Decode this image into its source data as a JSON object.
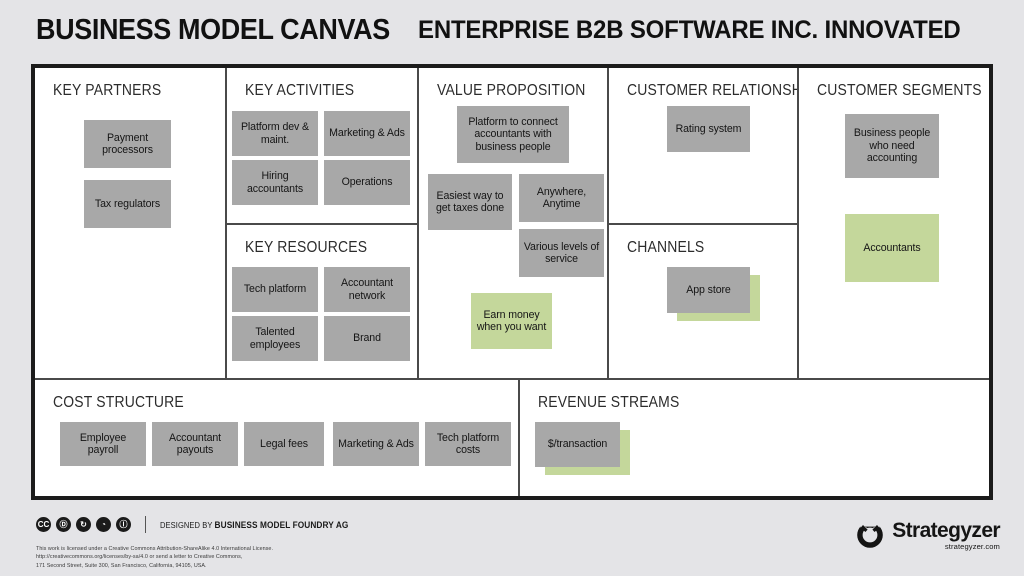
{
  "header": {
    "title": "BUSINESS MODEL CANVAS",
    "subtitle": "ENTERPRISE B2B SOFTWARE INC. INNOVATED"
  },
  "colors": {
    "page_background": "#e4e4e7",
    "canvas_background": "#ffffff",
    "frame": "#1b1b1b",
    "divider": "#4a4a4a",
    "card_gray": "#a8a8a8",
    "card_green": "#c4d79b",
    "text": "#151515"
  },
  "blocks": [
    {
      "id": "key-partners",
      "title": "KEY PARTNERS",
      "cards": [
        {
          "label": "Payment processors",
          "color": "gray"
        },
        {
          "label": "Tax regulators",
          "color": "gray"
        }
      ]
    },
    {
      "id": "key-activities",
      "title": "KEY ACTIVITIES",
      "cards": [
        {
          "label": "Platform dev & maint.",
          "color": "gray"
        },
        {
          "label": "Marketing & Ads",
          "color": "gray"
        },
        {
          "label": "Hiring accountants",
          "color": "gray"
        },
        {
          "label": "Operations",
          "color": "gray"
        }
      ]
    },
    {
      "id": "key-resources",
      "title": "KEY RESOURCES",
      "cards": [
        {
          "label": "Tech platform",
          "color": "gray"
        },
        {
          "label": "Accountant network",
          "color": "gray"
        },
        {
          "label": "Talented employees",
          "color": "gray"
        },
        {
          "label": "Brand",
          "color": "gray"
        }
      ]
    },
    {
      "id": "value-proposition",
      "title": "VALUE PROPOSITION",
      "cards": [
        {
          "label": "Platform to connect accountants with business people",
          "color": "gray"
        },
        {
          "label": "Easiest way to get taxes done",
          "color": "gray"
        },
        {
          "label": "Anywhere, Anytime",
          "color": "gray"
        },
        {
          "label": "Various levels of service",
          "color": "gray"
        },
        {
          "label": "Earn money when you want",
          "color": "green"
        }
      ]
    },
    {
      "id": "customer-relationships",
      "title": "CUSTOMER RELATIONSHIPS",
      "cards": [
        {
          "label": "Rating system",
          "color": "gray"
        }
      ]
    },
    {
      "id": "channels",
      "title": "CHANNELS",
      "cards": [
        {
          "label": "App store",
          "color": "gray",
          "stacked": true
        }
      ]
    },
    {
      "id": "customer-segments",
      "title": "CUSTOMER SEGMENTS",
      "cards": [
        {
          "label": "Business people who need accounting",
          "color": "gray"
        },
        {
          "label": "Accountants",
          "color": "green"
        }
      ]
    },
    {
      "id": "cost-structure",
      "title": "COST STRUCTURE",
      "cards": [
        {
          "label": "Employee payroll",
          "color": "gray"
        },
        {
          "label": "Accountant payouts",
          "color": "gray"
        },
        {
          "label": "Legal fees",
          "color": "gray"
        },
        {
          "label": "Marketing & Ads",
          "color": "gray"
        },
        {
          "label": "Tech platform costs",
          "color": "gray"
        }
      ]
    },
    {
      "id": "revenue-streams",
      "title": "REVENUE STREAMS",
      "cards": [
        {
          "label": "$/transaction",
          "color": "gray",
          "stacked": true
        }
      ]
    }
  ],
  "footer": {
    "cc_icons": [
      "cc-icon",
      "cc-copy-icon",
      "cc-sharealike-icon",
      "cc-remix-icon",
      "cc-by-icon"
    ],
    "cc_glyphs": [
      "CC",
      "Ⓓ",
      "↻",
      "◔",
      "Ⓘ"
    ],
    "designed_by_prefix": "DESIGNED BY ",
    "designed_by_name": "BUSINESS MODEL FOUNDRY AG",
    "license": "This work is licensed under a Creative Commons Attribution-ShareAlike 4.0 International License.\nhttp://creativecommons.org/licenses/by-sa/4.0 or send a letter to Creative Commons,\n171 Second Street, Suite 300, San Francisco, California, 94105, USA.",
    "brand_name": "Strategyzer",
    "brand_url": "strategyzer.com"
  }
}
